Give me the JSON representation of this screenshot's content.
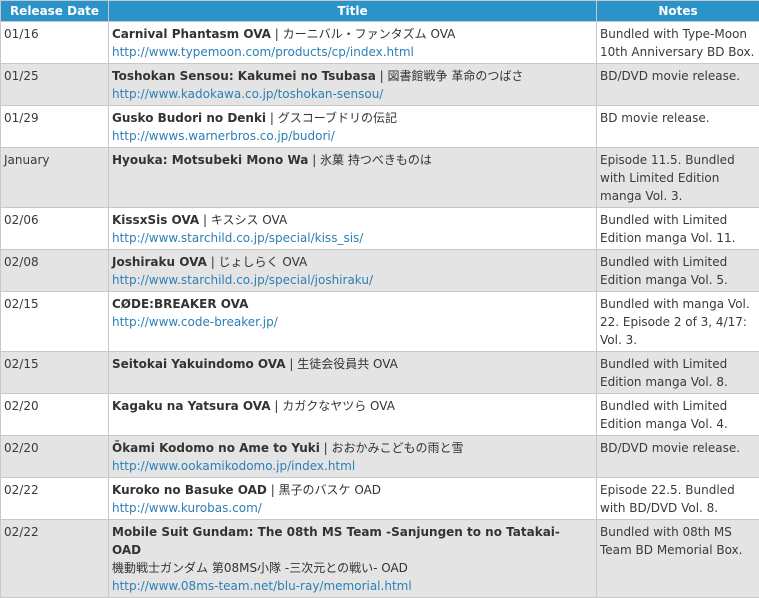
{
  "headers": {
    "release_date": "Release Date",
    "title": "Title",
    "notes": "Notes"
  },
  "rows": [
    {
      "date": "01/16",
      "name": "Carnival Phantasm OVA",
      "jp": "カーニバル・ファンタズム OVA",
      "url": "http://www.typemoon.com/products/cp/index.html",
      "notes": "Bundled with Type-Moon 10th Anniversary BD Box."
    },
    {
      "date": "01/25",
      "name": "Toshokan Sensou: Kakumei no Tsubasa",
      "jp": "図書館戦争 革命のつばさ",
      "url": "http://www.kadokawa.co.jp/toshokan-sensou/",
      "notes": "BD/DVD movie release."
    },
    {
      "date": "01/29",
      "name": "Gusko Budori no Denki",
      "jp": "グスコーブドリの伝記",
      "url": "http://wwws.warnerbros.co.jp/budori/",
      "notes": "BD movie release."
    },
    {
      "date": "January",
      "name": "Hyouka: Motsubeki Mono Wa",
      "jp": "氷菓 持つべきものは",
      "url": "",
      "notes": "Episode 11.5. Bundled with Limited Edition manga Vol. 3."
    },
    {
      "date": "02/06",
      "name": "KissxSis OVA",
      "jp": "キスシス OVA",
      "url": "http://www.starchild.co.jp/special/kiss_sis/",
      "notes": "Bundled with Limited Edition manga Vol. 11."
    },
    {
      "date": "02/08",
      "name": "Joshiraku OVA",
      "jp": "じょしらく OVA",
      "url": "http://www.starchild.co.jp/special/joshiraku/",
      "notes": "Bundled with Limited Edition manga Vol. 5."
    },
    {
      "date": "02/15",
      "name": "CØDE:BREAKER OVA",
      "jp": "",
      "url": "http://www.code-breaker.jp/",
      "notes": "Bundled with manga Vol. 22. Episode 2 of 3, 4/17: Vol. 3."
    },
    {
      "date": "02/15",
      "name": "Seitokai Yakuindomo OVA",
      "jp": "生徒会役員共 OVA",
      "url": "",
      "notes": "Bundled with Limited Edition manga Vol. 8."
    },
    {
      "date": "02/20",
      "name": "Kagaku na Yatsura OVA",
      "jp": "カガクなヤツら OVA",
      "url": "",
      "notes": "Bundled with Limited Edition manga Vol. 4."
    },
    {
      "date": "02/20",
      "name": "Ōkami Kodomo no Ame to Yuki",
      "jp": "おおかみこどもの雨と雪",
      "url": "http://www.ookamikodomo.jp/index.html",
      "notes": "BD/DVD movie release."
    },
    {
      "date": "02/22",
      "name": "Kuroko no Basuke OAD",
      "jp": "黒子のバスケ OAD",
      "url": "http://www.kurobas.com/",
      "notes": "Episode 22.5. Bundled with BD/DVD Vol. 8."
    },
    {
      "date": "02/22",
      "name": "Mobile Suit Gundam: The 08th MS Team -Sanjungen to no Tatakai- OAD",
      "jp": "",
      "line2": "機動戦士ガンダム 第08MS小隊 -三次元との戦い- OAD",
      "url": "http://www.08ms-team.net/blu-ray/memorial.html",
      "notes": "Bundled with 08th MS Team BD Memorial Box."
    }
  ]
}
